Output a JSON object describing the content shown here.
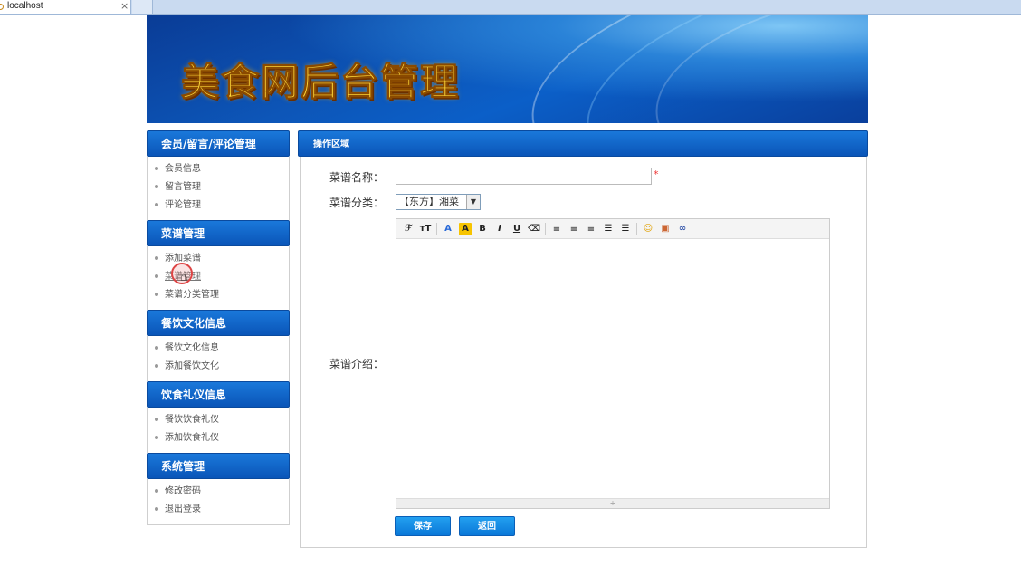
{
  "browser": {
    "tab_title": "localhost",
    "close_glyph": "×"
  },
  "banner": {
    "heading": "美食网后台管理"
  },
  "sidebar": {
    "sections": [
      {
        "title": "会员/留言/评论管理",
        "items": [
          "会员信息",
          "留言管理",
          "评论管理"
        ]
      },
      {
        "title": "菜谱管理",
        "items": [
          "添加菜谱",
          "菜谱管理",
          "菜谱分类管理"
        ]
      },
      {
        "title": "餐饮文化信息",
        "items": [
          "餐饮文化信息",
          "添加餐饮文化"
        ]
      },
      {
        "title": "饮食礼仪信息",
        "items": [
          "餐饮饮食礼仪",
          "添加饮食礼仪"
        ]
      },
      {
        "title": "系统管理",
        "items": [
          "修改密码",
          "退出登录"
        ]
      }
    ]
  },
  "main": {
    "header": "操作区域",
    "form": {
      "name_label": "菜谱名称：",
      "name_value": "",
      "required_mark": "*",
      "category_label": "菜谱分类：",
      "category_value": "【东方】湘菜",
      "intro_label": "菜谱介绍：",
      "toolbar": [
        "font-family-icon",
        "font-size-icon",
        "font-color-icon",
        "highlight-color-icon",
        "bold-icon",
        "italic-icon",
        "underline-icon",
        "remove-format-icon",
        "align-left-icon",
        "align-center-icon",
        "align-right-icon",
        "ordered-list-icon",
        "unordered-list-icon",
        "emoticon-icon",
        "image-icon",
        "link-icon"
      ],
      "save_label": "保存",
      "back_label": "返回"
    }
  },
  "colors": {
    "header_blue": "#0a55b8",
    "button_blue": "#0a78d8",
    "required_red": "#e33"
  }
}
